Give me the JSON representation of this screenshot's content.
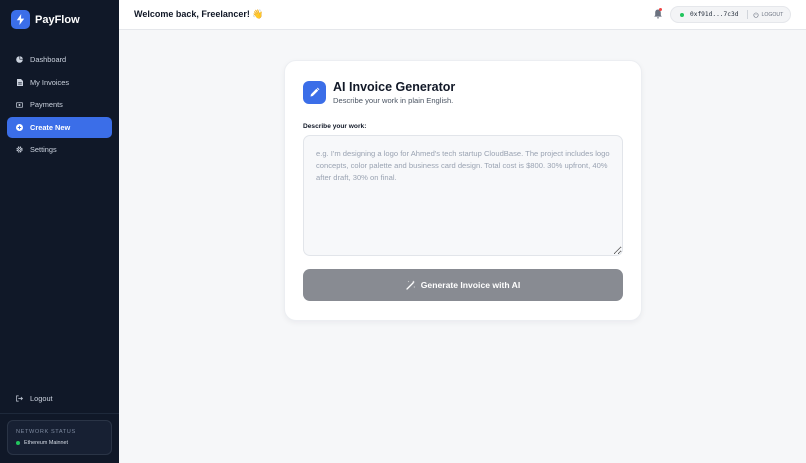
{
  "brand": {
    "name": "PayFlow"
  },
  "sidebar": {
    "items": [
      {
        "label": "Dashboard",
        "icon": "dashboard-icon",
        "active": false
      },
      {
        "label": "My Invoices",
        "icon": "document-icon",
        "active": false
      },
      {
        "label": "Payments",
        "icon": "payments-icon",
        "active": false
      },
      {
        "label": "Create New",
        "icon": "plus-circle-icon",
        "active": true
      },
      {
        "label": "Settings",
        "icon": "gear-icon",
        "active": false
      }
    ],
    "logout_label": "Logout",
    "network": {
      "label": "NETWORK STATUS",
      "value": "Ethereum Mainnet",
      "status_color": "#22c55e"
    }
  },
  "header": {
    "welcome": "Welcome back, Freelancer! 👋",
    "wallet_address": "0xf91d...7c3d",
    "logout_label": "LOGOUT"
  },
  "card": {
    "title": "AI Invoice Generator",
    "subtitle": "Describe your work in plain English.",
    "field_label": "Describe your work:",
    "placeholder": "e.g. I'm designing a logo for Ahmed's tech startup CloudBase. The project includes logo concepts, color palette and business card design. Total cost is $800. 30% upfront, 40% after draft, 30% on final.",
    "value": "",
    "button_label": "Generate Invoice with AI"
  },
  "colors": {
    "accent": "#3b6ee8",
    "sidebar_bg": "#101828",
    "button_disabled": "#888b92",
    "status_green": "#22c55e",
    "notification_red": "#ef4444"
  }
}
